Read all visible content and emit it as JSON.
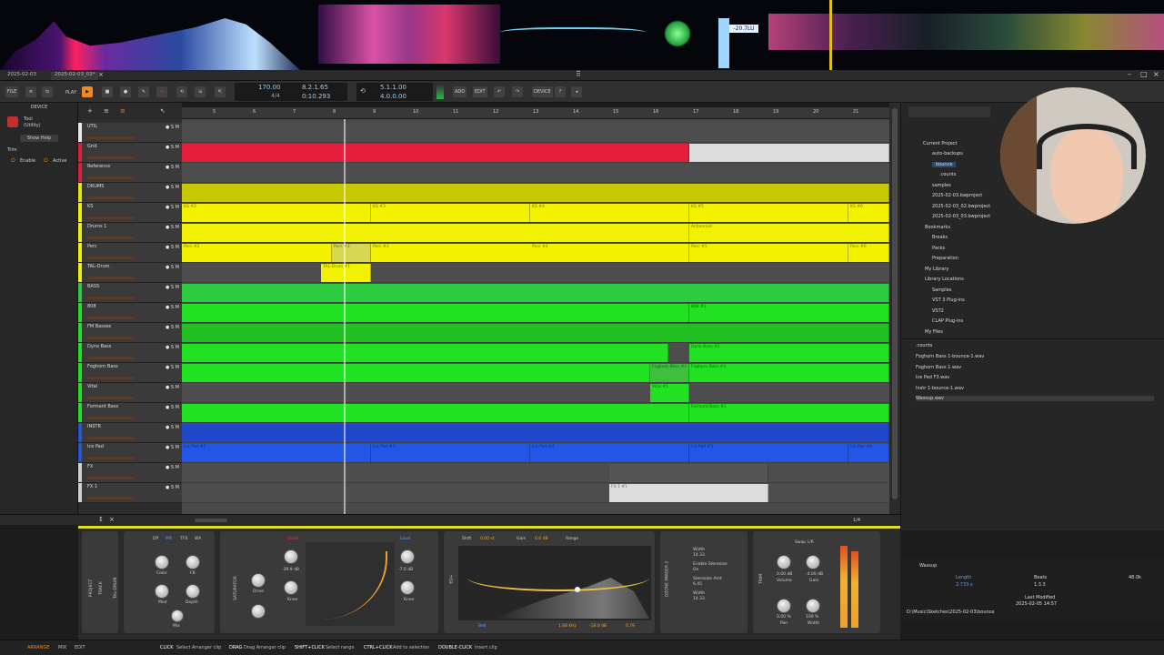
{
  "window": {
    "tabs": [
      "2025-02-03",
      "2025-02-03_03*"
    ]
  },
  "toolbar": {
    "file": "FILE",
    "play": "PLAY",
    "tempo": "170.00",
    "timesig": "4/4",
    "position": "8.2.1.65",
    "time": "0:10.293",
    "loop_start": "5.1.1.00",
    "loop_len": "4.0.0.00",
    "add": "ADD",
    "edit": "EDIT",
    "device": "DEVICE",
    "loudness": "-20.7LU"
  },
  "leftpanel": {
    "header": "DEVICE",
    "tool_name": "Tool",
    "tool_type": "(Utility)",
    "show_help": "Show Help",
    "trim": "Trim",
    "enable": "Enable",
    "active": "Active"
  },
  "tracks": [
    {
      "name": "UTIL",
      "color": "#e8e8e8"
    },
    {
      "name": "Grid",
      "color": "#e0203a"
    },
    {
      "name": "Reference",
      "color": "#e0203a"
    },
    {
      "name": "DRUMS",
      "color": "#e6e600"
    },
    {
      "name": "KS",
      "color": "#f2f200"
    },
    {
      "name": "Drums 1",
      "color": "#f2f200"
    },
    {
      "name": "Perc",
      "color": "#f2f200"
    },
    {
      "name": "TAL-Drum",
      "color": "#f2f200"
    },
    {
      "name": "BASS",
      "color": "#2ecc40"
    },
    {
      "name": "808",
      "color": "#22e022"
    },
    {
      "name": "FM Basses",
      "color": "#22e022"
    },
    {
      "name": "Dyno Bass",
      "color": "#22e022"
    },
    {
      "name": "Foghorn Bass",
      "color": "#22e022"
    },
    {
      "name": "Vital",
      "color": "#22e022"
    },
    {
      "name": "Formant Bass",
      "color": "#22e022"
    },
    {
      "name": "INSTR",
      "color": "#2456d6"
    },
    {
      "name": "Ice Pad",
      "color": "#2456d6"
    },
    {
      "name": "FX",
      "color": "#d0d0d0"
    },
    {
      "name": "FX 1",
      "color": "#d0d0d0"
    }
  ],
  "ruler": [
    "5",
    "6",
    "7",
    "8",
    "9",
    "10",
    "11",
    "12",
    "13",
    "14",
    "15",
    "16",
    "17",
    "18",
    "19",
    "20",
    "21"
  ],
  "clips": {
    "ks2": "KS #2",
    "ks3": "KS #3",
    "ks4": "KS #4",
    "ks5": "KS #5",
    "ks6": "KS #6",
    "actionroid": "Actionroid",
    "perc2": "Perc #2",
    "perc3a": "Perc #3",
    "perc3": "Perc #3",
    "perc4": "Perc #4",
    "perc5": "Perc #5",
    "perc6": "Perc #6",
    "taldrum": "TAL-Drum #1",
    "b808": "808 #2",
    "dyno": "Dyno Bass #2",
    "foghorn_a": "Foghorn Bass #2",
    "foghorn_b": "Foghorn Bass #3",
    "vital": "Vital #1",
    "formant": "Formant Bass #2",
    "icepad2": "Ice Pad #2",
    "icepad3": "Ice Pad #3",
    "icepad4": "Ice Pad #4",
    "icepad5": "Ice Pad #5",
    "icepad6": "Ice Pad #6",
    "fx1": "FX 1 #1"
  },
  "browser": {
    "current_project": "Current Project",
    "items": [
      "auto-backups",
      "bounce",
      ".counts",
      "samples",
      "2025-02-03.bwproject",
      "2025-02-03_02.bwproject",
      "2025-02-03_03.bwproject"
    ],
    "bookmarks": "Bookmarks",
    "bookmark_items": [
      "Breaks",
      "Packs",
      "Preparation"
    ],
    "my_library": "My Library",
    "library_locations": "Library Locations",
    "library_items": [
      "Samples",
      "VST 3 Plug-ins",
      "VST2",
      "CLAP Plug-ins"
    ],
    "my_files": "My Files",
    "files": [
      ".counts",
      "Foghorn Bass 1-bounce-1.wav",
      "Foghorn Bass 1.wav",
      "Ice Pad F3.wav",
      "Instr 1-bounce-1.wav",
      "Wassup.wav"
    ],
    "preview_name": "Wassup",
    "length_label": "Length",
    "length_value": "2.733 s",
    "beats_label": "Beats",
    "beats_value": "1.3.3",
    "rate_value": "48.0k",
    "last_modified_label": "Last Modified",
    "last_modified_value": "2025-02-05 14:57",
    "path": "D:\\Music\\Sketches\\2025-02-03\\bounce"
  },
  "devicebar": {
    "page": "1/4"
  },
  "devices": {
    "project": "PROJECT",
    "track": "TRACK",
    "taldrum": "TAL-DRUM",
    "tabs": [
      "DP",
      "MX",
      "TFX",
      "WA"
    ],
    "color": "Color",
    "fb": "FB",
    "mod": "Mod",
    "depth": "Depth",
    "mix": "Mix",
    "saturator": "SATURATOR",
    "drive": "Drive",
    "knee": "Knee",
    "quiet": "Quiet",
    "loud": "Loud",
    "drive_val": "-39.9 dB",
    "loud_val": "-7.0 dB",
    "shift": "Shift",
    "shift_val": "0.00 st",
    "gain": "Gain",
    "gain_val": "0.0 dB",
    "range": "Range",
    "eq": "EQ+",
    "bell": "Bell",
    "freq": "1.68 kHz",
    "eqgain": "-18.0 dB",
    "q": "0.79",
    "ozone": "OZONE IMAGER 2",
    "width": "Width",
    "width_val": "14.33",
    "enable_stereoize": "Enable Stereoize",
    "on": "On",
    "stereoize_amt": "Stereoize Amt",
    "stereoize_val": "6.45",
    "width2": "Width",
    "width2_val": "14.33",
    "trim": "TRIM",
    "swap": "Swap L/R",
    "volume": "Volume",
    "volume_val": "0.00 dB",
    "gain2": "Gain",
    "gain2_val": "-4.00 dB",
    "pan": "Pan",
    "width3": "Width",
    "pan_val": "0.00 %",
    "width3_val": "100 %"
  },
  "statusbar": {
    "arrange": "ARRANGE",
    "mix": "MIX",
    "edit": "EDIT",
    "hints": [
      {
        "key": "CLICK",
        "text": "Select Arranger clip"
      },
      {
        "key": "DRAG",
        "text": "Drag Arranger clip"
      },
      {
        "key": "SHIFT+CLICK",
        "text": "Select range"
      },
      {
        "key": "CTRL+CLICK",
        "text": "Add to selection"
      },
      {
        "key": "DOUBLE-CLICK",
        "text": "Insert clip"
      }
    ]
  }
}
